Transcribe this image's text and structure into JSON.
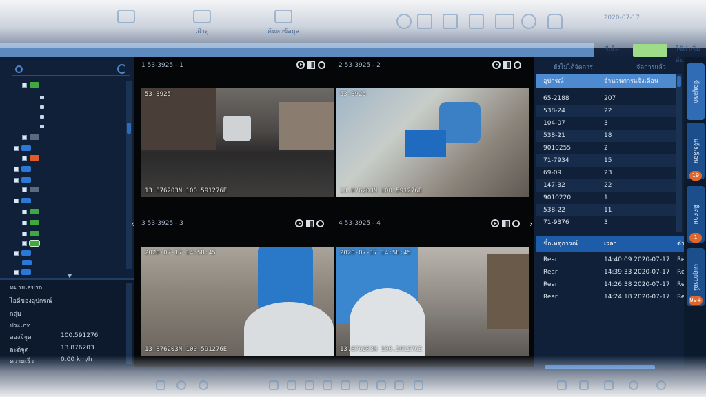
{
  "topbar": {
    "items": [
      "",
      "เฝ้าดู",
      "ค้นหาข้อมูล"
    ],
    "clock_time": "",
    "clock_date": "2020-07-17"
  },
  "strip": {
    "btn1": "รีเซ็ต",
    "btn2": "ใช้ค่าเริ่มต้น"
  },
  "info": {
    "rows": [
      {
        "label": "หมายเลขรถ",
        "value": ""
      },
      {
        "label": "ไอดีของอุปกรณ์",
        "value": ""
      },
      {
        "label": "กลุ่ม",
        "value": ""
      },
      {
        "label": "ประเภท",
        "value": ""
      },
      {
        "label": "ลองจิจูด",
        "value": "100.591276"
      },
      {
        "label": "ละติจูด",
        "value": "13.876203"
      },
      {
        "label": "ความเร็ว",
        "value": "0.00 km/h"
      }
    ]
  },
  "videos": [
    {
      "title": "1 53-3925 - 1",
      "osd_top": "2020-07-17 14:58:45",
      "osd_top2": "53-3925",
      "osd_bottom": "13.876203N 100.591276E"
    },
    {
      "title": "2 53-3925 - 2",
      "osd_top": "2020-07-17 14:58:45",
      "osd_top2": "53-3925",
      "osd_bottom": "13.876203N 100.591276E"
    },
    {
      "title": "3 53-3925 - 3",
      "osd_top": "2020-07-17 14:58:45",
      "osd_top2": "53-3925",
      "osd_bottom": "13.876203N 100.591276E"
    },
    {
      "title": "4 53-3925 - 4",
      "osd_top": "2020-07-17 14:58:45",
      "osd_top2": "53-3925",
      "osd_bottom": "13.876203N 100.591276E"
    }
  ],
  "right": {
    "tab1": "ยังไม่ได้จัดการ",
    "tab2": "จัดการแล้ว",
    "col1": "อุปกรณ์",
    "col2": "จำนวนการแจ้งเตือน",
    "rows": [
      {
        "device": "65-2188",
        "count": "207"
      },
      {
        "device": "538-24",
        "count": "22"
      },
      {
        "device": "104-07",
        "count": "3"
      },
      {
        "device": "538-21",
        "count": "18"
      },
      {
        "device": "9010255",
        "count": "2"
      },
      {
        "device": "71-7934",
        "count": "15"
      },
      {
        "device": "69-09",
        "count": "23"
      },
      {
        "device": "147-32",
        "count": "22"
      },
      {
        "device": "9010220",
        "count": "1"
      },
      {
        "device": "538-22",
        "count": "11"
      },
      {
        "device": "71-9376",
        "count": "3"
      }
    ],
    "events_head": {
      "c1": "ชื่อเหตุการณ์",
      "c2": "เวลา",
      "c3": "ตำ"
    },
    "events": [
      {
        "name": "Rear",
        "time": "14:40:09 2020-07-17",
        "extra": "Re"
      },
      {
        "name": "Rear",
        "time": "14:39:33 2020-07-17",
        "extra": "Re"
      },
      {
        "name": "Rear",
        "time": "14:26:38 2020-07-17",
        "extra": "Re"
      },
      {
        "name": "Rear",
        "time": "14:24:18 2020-07-17",
        "extra": "Re"
      }
    ]
  },
  "vtabs": [
    {
      "label": "ข้อมูลรถ",
      "badge": ""
    },
    {
      "label": "แจ้งเตือน",
      "badge": "19"
    },
    {
      "label": "ติดตาม",
      "badge": "1"
    },
    {
      "label": "เหตุการณ์",
      "badge": "99+"
    }
  ],
  "colors": {
    "accent": "#4d8ad0",
    "badge": "#e0662a",
    "green": "#9fdc8a"
  }
}
